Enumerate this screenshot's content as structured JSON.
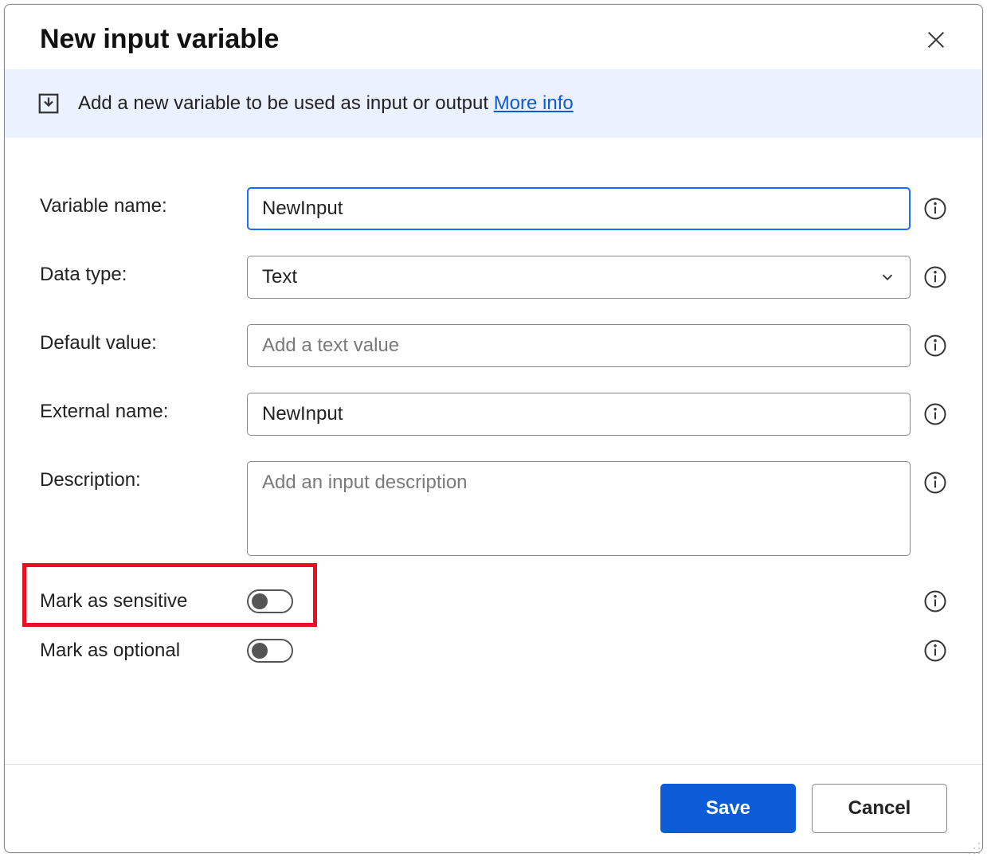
{
  "header": {
    "title": "New input variable"
  },
  "banner": {
    "text": "Add a new variable to be used as input or output ",
    "link_label": "More info"
  },
  "form": {
    "variable_name": {
      "label": "Variable name:",
      "value": "NewInput"
    },
    "data_type": {
      "label": "Data type:",
      "value": "Text"
    },
    "default_value": {
      "label": "Default value:",
      "value": "",
      "placeholder": "Add a text value"
    },
    "external_name": {
      "label": "External name:",
      "value": "NewInput"
    },
    "description": {
      "label": "Description:",
      "value": "",
      "placeholder": "Add an input description"
    },
    "mark_sensitive": {
      "label": "Mark as sensitive",
      "value": false
    },
    "mark_optional": {
      "label": "Mark as optional",
      "value": false
    }
  },
  "footer": {
    "save_label": "Save",
    "cancel_label": "Cancel"
  }
}
